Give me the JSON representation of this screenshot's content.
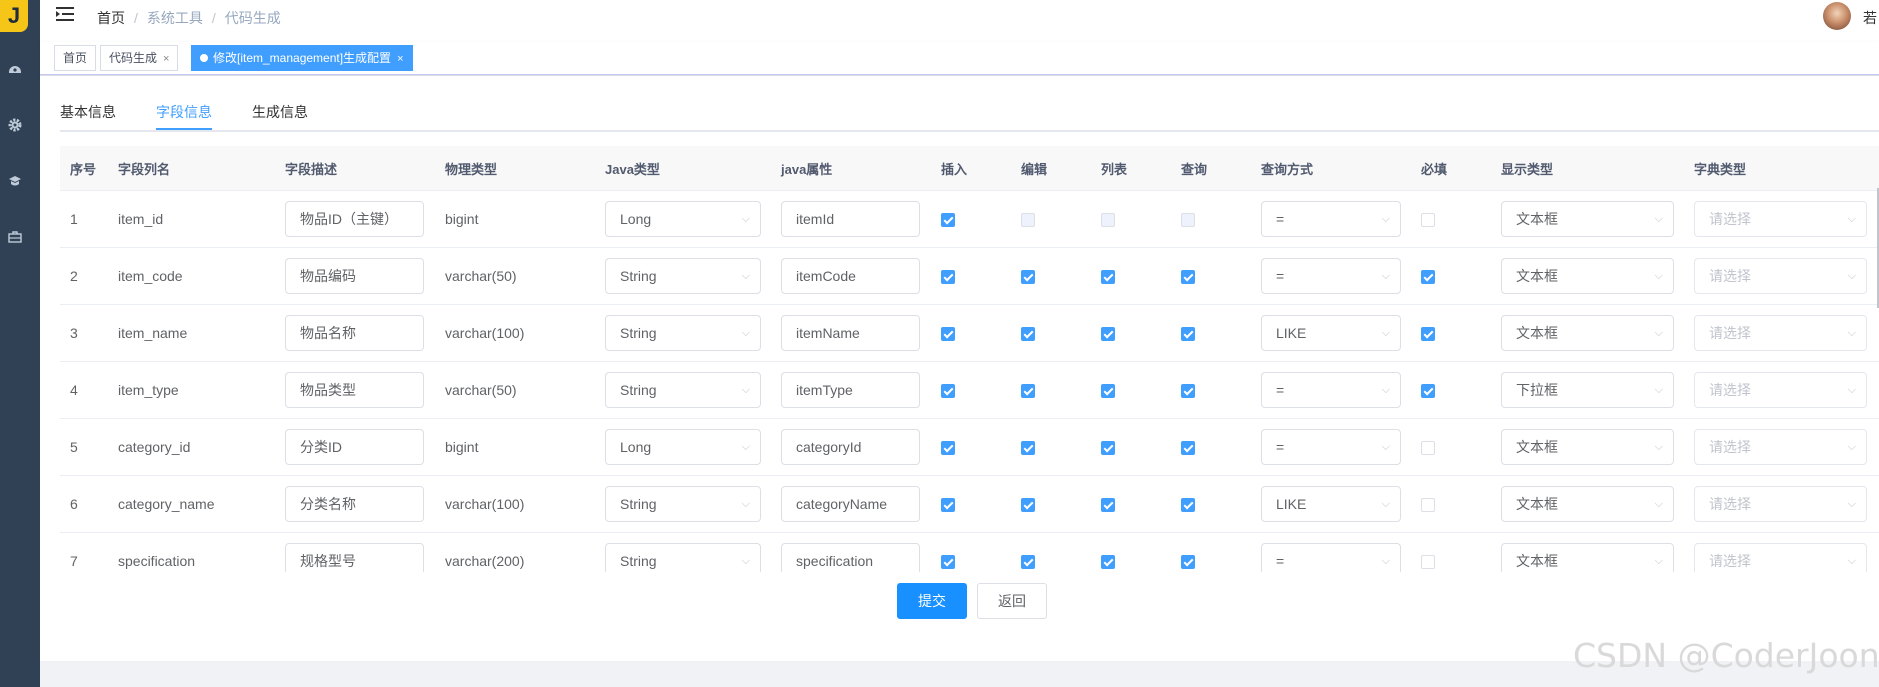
{
  "sidebar": {
    "logo_text": "J",
    "icons": [
      "dashboard-icon",
      "gear-icon",
      "monitor-icon",
      "toolbox-icon"
    ]
  },
  "navbar": {
    "breadcrumb": [
      "首页",
      "系统工具",
      "代码生成"
    ],
    "avatar_text": "若"
  },
  "tags": [
    {
      "label": "首页"
    },
    {
      "label": "代码生成",
      "close": "×"
    },
    {
      "label": "修改[item_management]生成配置",
      "close": "×"
    }
  ],
  "tabs": [
    "基本信息",
    "字段信息",
    "生成信息"
  ],
  "columns": [
    "序号",
    "字段列名",
    "字段描述",
    "物理类型",
    "Java类型",
    "java属性",
    "插入",
    "编辑",
    "列表",
    "查询",
    "查询方式",
    "必填",
    "显示类型",
    "字典类型"
  ],
  "rows": [
    {
      "no": "1",
      "name": "item_id",
      "desc": "物品ID（主键）",
      "ptype": "bigint",
      "jtype": "Long",
      "jattr": "itemId",
      "insert": true,
      "edit": false,
      "list": false,
      "query": false,
      "qtype": "=",
      "required": false,
      "display": "文本框",
      "dict": "请选择"
    },
    {
      "no": "2",
      "name": "item_code",
      "desc": "物品编码",
      "ptype": "varchar(50)",
      "jtype": "String",
      "jattr": "itemCode",
      "insert": true,
      "edit": true,
      "list": true,
      "query": true,
      "qtype": "=",
      "required": true,
      "display": "文本框",
      "dict": "请选择"
    },
    {
      "no": "3",
      "name": "item_name",
      "desc": "物品名称",
      "ptype": "varchar(100)",
      "jtype": "String",
      "jattr": "itemName",
      "insert": true,
      "edit": true,
      "list": true,
      "query": true,
      "qtype": "LIKE",
      "required": true,
      "display": "文本框",
      "dict": "请选择"
    },
    {
      "no": "4",
      "name": "item_type",
      "desc": "物品类型",
      "ptype": "varchar(50)",
      "jtype": "String",
      "jattr": "itemType",
      "insert": true,
      "edit": true,
      "list": true,
      "query": true,
      "qtype": "=",
      "required": true,
      "display": "下拉框",
      "dict": "请选择"
    },
    {
      "no": "5",
      "name": "category_id",
      "desc": "分类ID",
      "ptype": "bigint",
      "jtype": "Long",
      "jattr": "categoryId",
      "insert": true,
      "edit": true,
      "list": true,
      "query": true,
      "qtype": "=",
      "required": false,
      "display": "文本框",
      "dict": "请选择"
    },
    {
      "no": "6",
      "name": "category_name",
      "desc": "分类名称",
      "ptype": "varchar(100)",
      "jtype": "String",
      "jattr": "categoryName",
      "insert": true,
      "edit": true,
      "list": true,
      "query": true,
      "qtype": "LIKE",
      "required": false,
      "display": "文本框",
      "dict": "请选择"
    },
    {
      "no": "7",
      "name": "specification",
      "desc": "规格型号",
      "ptype": "varchar(200)",
      "jtype": "String",
      "jattr": "specification",
      "insert": true,
      "edit": true,
      "list": true,
      "query": true,
      "qtype": "=",
      "required": false,
      "display": "文本框",
      "dict": "请选择"
    }
  ],
  "buttons": {
    "submit": "提交",
    "back": "返回"
  },
  "watermark": "CSDN @CoderJoon",
  "colors": {
    "primary": "#409eff",
    "sidebar": "#304156"
  }
}
